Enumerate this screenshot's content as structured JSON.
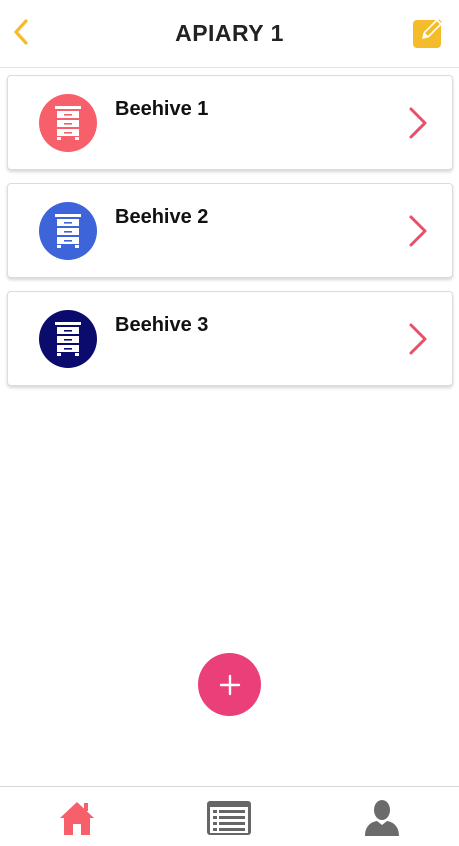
{
  "header": {
    "title": "APIARY 1",
    "accent_color": "#f4bc2a"
  },
  "beehives": [
    {
      "label": "Beehive 1",
      "color": "#f75f6a"
    },
    {
      "label": "Beehive 2",
      "color": "#3d64d8"
    },
    {
      "label": "Beehive 3",
      "color": "#0b0b6e"
    }
  ],
  "chevron_color": "#ea4f6a",
  "fab": {
    "icon": "plus-icon",
    "color": "#ea3f78"
  },
  "tabbar": {
    "tabs": [
      {
        "icon": "home-icon",
        "color": "#f75f6a",
        "active": true
      },
      {
        "icon": "list-icon",
        "color": "#666666",
        "active": false
      },
      {
        "icon": "profile-icon",
        "color": "#6b6b6b",
        "active": false
      }
    ]
  }
}
